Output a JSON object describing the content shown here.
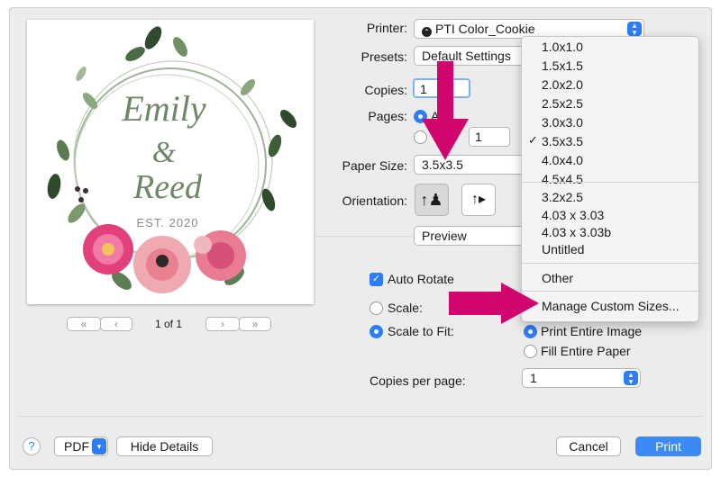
{
  "printer": {
    "label": "Printer:",
    "value": "PTI Color_Cookie"
  },
  "presets": {
    "label": "Presets:",
    "value": "Default Settings"
  },
  "copies": {
    "label": "Copies:",
    "value": "1"
  },
  "pages": {
    "label": "Pages:",
    "all_label": "A",
    "from_value": "1"
  },
  "paper_size": {
    "label": "Paper Size:",
    "value": "3.5x3.5"
  },
  "orientation": {
    "label": "Orientation:"
  },
  "section_select": {
    "value": "Preview"
  },
  "auto_rotate": {
    "label": "Auto Rotate",
    "checked": true
  },
  "scale": {
    "label": "Scale:"
  },
  "scale_to_fit": {
    "label": "Scale to Fit:",
    "print_entire_image": "Print Entire Image",
    "fill_entire_paper": "Fill Entire Paper"
  },
  "copies_per_page": {
    "label": "Copies per page:",
    "value": "1"
  },
  "preview_image": {
    "line1": "Emily",
    "line2": "&",
    "line3": "Reed",
    "line4": "EST. 2020"
  },
  "pager": {
    "first": "«",
    "prev": "‹",
    "page_text": "1 of 1",
    "next": "›",
    "last": "»"
  },
  "paper_menu": {
    "group1": [
      "1.0x1.0",
      "1.5x1.5",
      "2.0x2.0",
      "2.5x2.5",
      "3.0x3.0",
      "3.5x3.5",
      "4.0x4.0",
      "4.5x4.5"
    ],
    "selected": "3.5x3.5",
    "group2": [
      "3.2x2.5",
      "4.03 x 3.03",
      "4.03 x 3.03b",
      "Untitled"
    ],
    "other": "Other",
    "manage": "Manage Custom Sizes..."
  },
  "footer": {
    "help": "?",
    "pdf": "PDF",
    "hide_details": "Hide Details",
    "cancel": "Cancel",
    "print": "Print"
  },
  "colors": {
    "accent": "#2f7df6",
    "arrow": "#d0056e"
  }
}
